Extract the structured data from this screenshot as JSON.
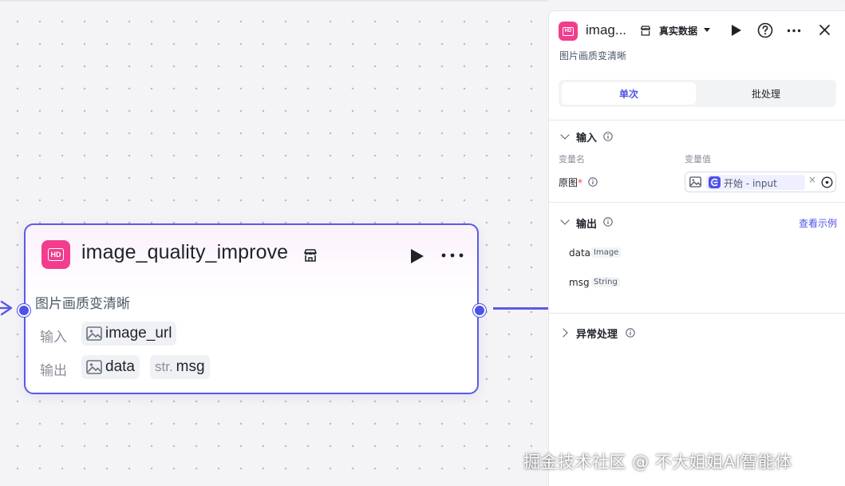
{
  "node": {
    "title": "image_quality_improve",
    "description": "图片画质变清晰",
    "input_label": "输入",
    "output_label": "输出",
    "inputs": [
      "image_url"
    ],
    "outputs": [
      {
        "name": "data",
        "kind": "image"
      },
      {
        "name": "msg",
        "kind": "str",
        "prefix": "str."
      }
    ],
    "accent_color": "#4f52e8",
    "icon_color": "#f23d8d"
  },
  "panel": {
    "title": "imag...",
    "mode": "真实数据",
    "description": "图片画质变清晰",
    "tabs": [
      {
        "label": "单次",
        "active": true
      },
      {
        "label": "批处理",
        "active": false
      }
    ],
    "input_section": {
      "title": "输入",
      "col_name": "变量名",
      "col_value": "变量值",
      "var_name": "原图",
      "required_mark": "*",
      "value_ref": "开始 - input"
    },
    "output_section": {
      "title": "输出",
      "view_example": "查看示例",
      "outputs": [
        {
          "name": "data",
          "type": "Image"
        },
        {
          "name": "msg",
          "type": "String"
        }
      ]
    },
    "error_section": {
      "title": "异常处理"
    }
  },
  "watermark": "掘金技术社区 @ 不大姐姐AI智能体"
}
